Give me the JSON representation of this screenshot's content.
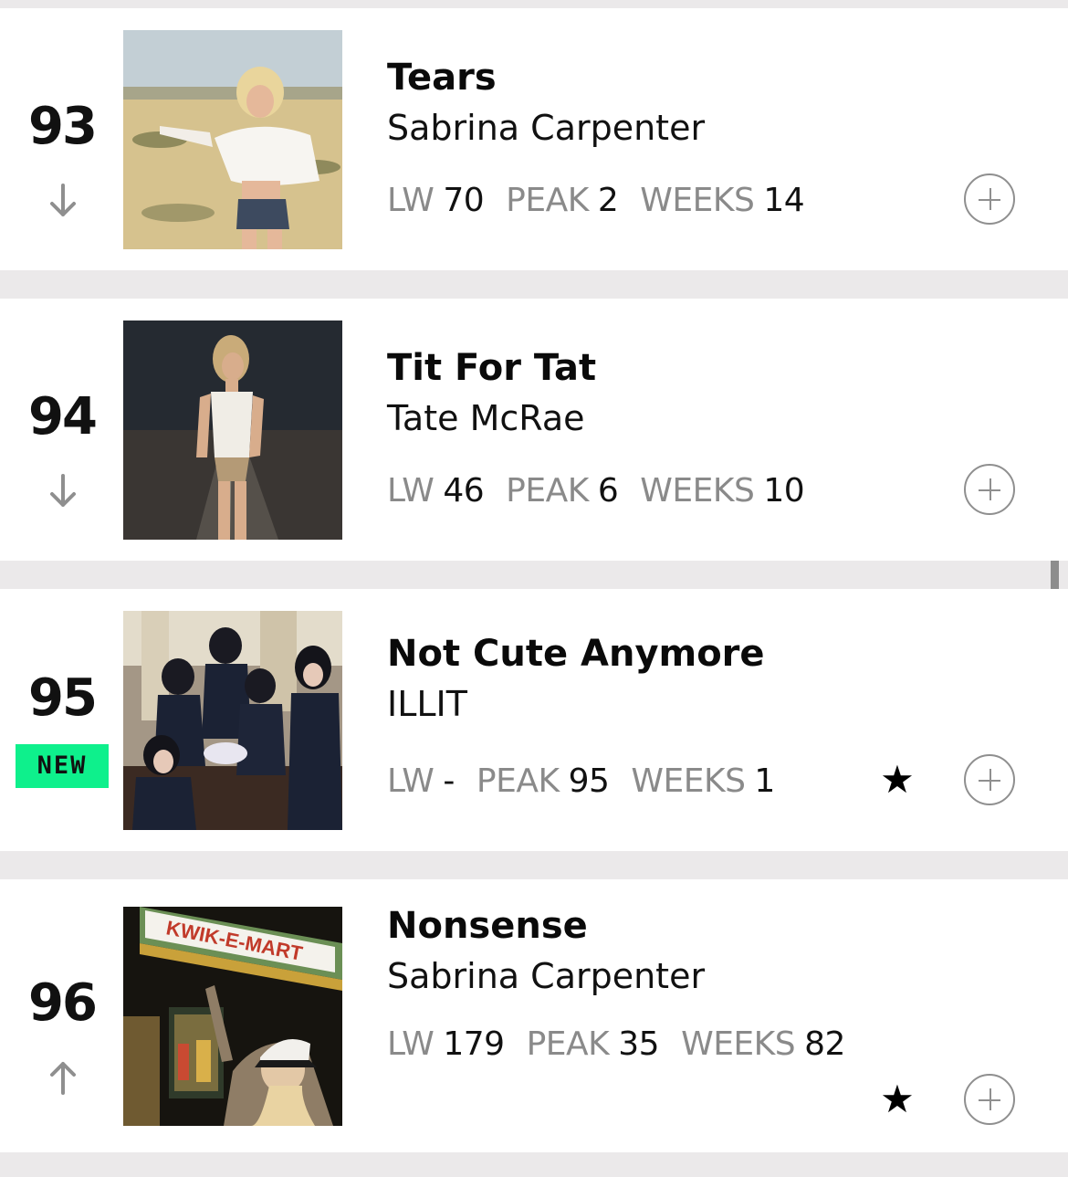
{
  "entries": [
    {
      "rank": "93",
      "trend": "down",
      "title": "Tears",
      "artist": "Sabrina Carpenter",
      "lw_label": "LW",
      "lw": "70",
      "peak_label": "PEAK",
      "peak": "2",
      "weeks_label": "WEEKS",
      "weeks": "14"
    },
    {
      "rank": "94",
      "trend": "down",
      "title": "Tit For Tat",
      "artist": "Tate McRae",
      "lw_label": "LW",
      "lw": "46",
      "peak_label": "PEAK",
      "peak": "6",
      "weeks_label": "WEEKS",
      "weeks": "10"
    },
    {
      "rank": "95",
      "badge": "NEW",
      "title": "Not Cute Anymore",
      "artist": "ILLIT",
      "lw_label": "LW",
      "lw": "-",
      "peak_label": "PEAK",
      "peak": "95",
      "weeks_label": "WEEKS",
      "weeks": "1",
      "star_icon": "★"
    },
    {
      "rank": "96",
      "trend": "up",
      "title": "Nonsense",
      "artist": "Sabrina Carpenter",
      "lw_label": "LW",
      "lw": "179",
      "peak_label": "PEAK",
      "peak": "35",
      "weeks_label": "WEEKS",
      "weeks": "82",
      "star_icon": "★",
      "art_sign": "KWIK-E-MART"
    }
  ],
  "colors": {
    "page_bg": "#ebe9ea",
    "new_badge": "#0ef08c",
    "muted_label": "#8a8a8a"
  }
}
